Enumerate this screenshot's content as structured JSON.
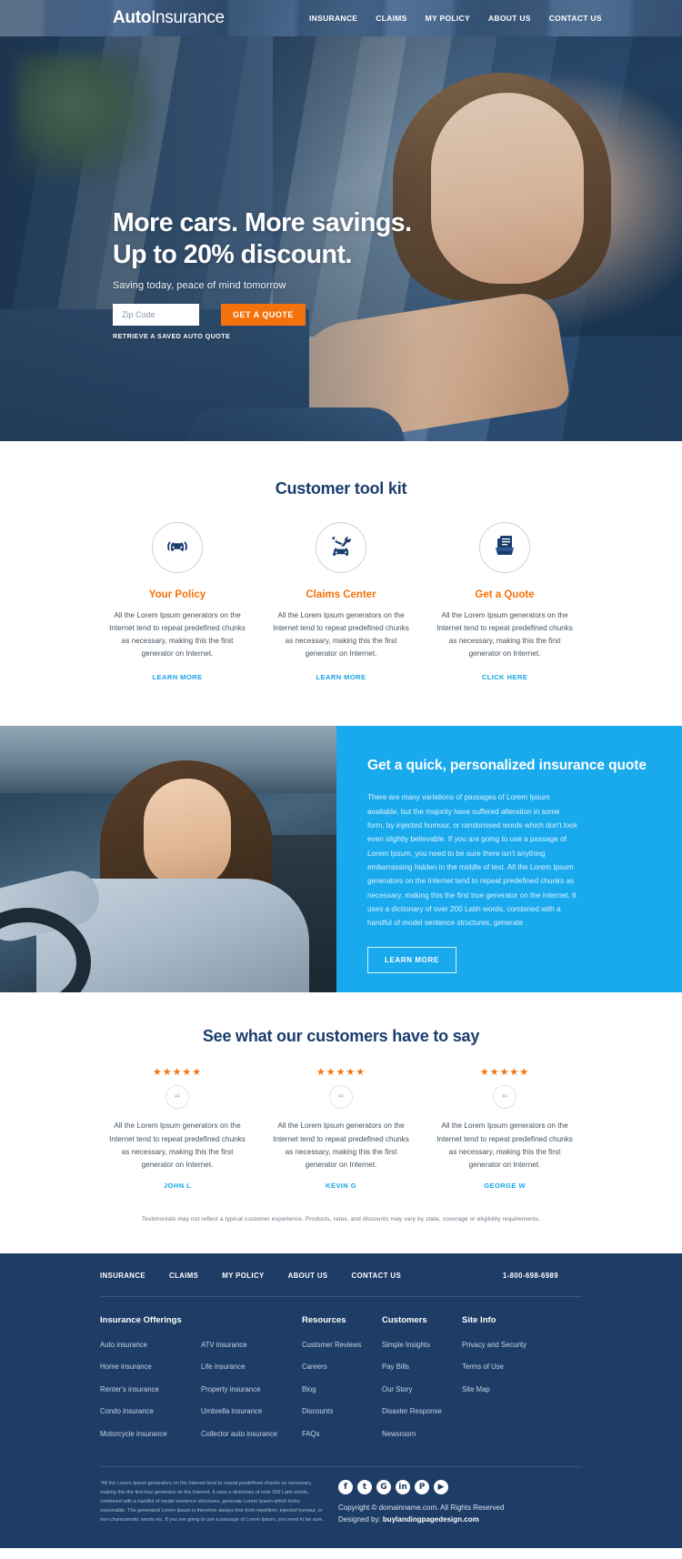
{
  "header": {
    "logo_bold": "Auto",
    "logo_light": "Insurance",
    "nav": [
      "INSURANCE",
      "CLAIMS",
      "MY POLICY",
      "ABOUT US",
      "CONTACT US"
    ]
  },
  "hero": {
    "title_line1": "More cars. More savings.",
    "title_line2": "Up to 20% discount.",
    "subtitle": "Saving today, peace of mind tomorrow",
    "zip_placeholder": "Zip Code",
    "zip_value": "",
    "cta_label": "GET A QUOTE",
    "retrieve_label": "RETRIEVE A SAVED AUTO QUOTE",
    "accent_color": "#f4720b"
  },
  "toolkit": {
    "title": "Customer tool kit",
    "cards": [
      {
        "icon": "car-in-hands-icon",
        "title": "Your Policy",
        "text": "All the Lorem Ipsum generators on the Internet tend to repeat predefined chunks as necessary, making this the first generator on Internet.",
        "link": "LEARN MORE"
      },
      {
        "icon": "car-wrench-icon",
        "title": "Claims Center",
        "text": "All the Lorem Ipsum generators on the Internet tend to repeat predefined chunks as necessary, making this the first generator on Internet.",
        "link": "LEARN MORE"
      },
      {
        "icon": "documents-folder-icon",
        "title": "Get a Quote",
        "text": "All the Lorem Ipsum generators on the Internet tend to repeat predefined chunks as necessary, making this the first generator on Internet.",
        "link": "CLICK HERE"
      }
    ]
  },
  "quote_section": {
    "heading": "Get a quick, personalized insurance quote",
    "body": "There are many variations of passages of Lorem Ipsum available, but the majority have suffered alteration in some form, by injected humour, or randomised words which don't look even slightly believable. If you are going to use a passage of Lorem Ipsum, you need to be sure there isn't anything embarrassing hidden in the middle of text. All the Lorem Ipsum generators on the Internet tend to repeat predefined chunks as necessary, making this the first true generator on the Internet. It uses a dictionary of over 200 Latin words, combined with a handful of model sentence structures, generate .",
    "button": "LEARN MORE",
    "background_color": "#19a9ed"
  },
  "testimonials": {
    "title": "See what our customers have to say",
    "items": [
      {
        "stars": "★★★★★",
        "quote_icon": "quote-mark-icon",
        "text": "All the Lorem Ipsum generators on the Internet tend to repeat predefined chunks as necessary, making this the first generator on Internet.",
        "author": "JOHN L"
      },
      {
        "stars": "★★★★★",
        "quote_icon": "quote-mark-icon",
        "text": "All the Lorem Ipsum generators on the Internet tend to repeat predefined chunks as necessary, making this the first generator on Internet.",
        "author": "KEVIN G"
      },
      {
        "stars": "★★★★★",
        "quote_icon": "quote-mark-icon",
        "text": "All the Lorem Ipsum generators on the Internet tend to repeat predefined chunks as necessary, making this the first generator on Internet.",
        "author": "GEORGE W"
      }
    ],
    "disclaimer": "Testimonials may not reflect a typical customer experience. Products, rates, and discounts may vary by state, coverage or eligibility requirements."
  },
  "footer": {
    "nav": [
      "INSURANCE",
      "CLAIMS",
      "MY POLICY",
      "ABOUT US",
      "CONTACT US"
    ],
    "phone": "1-800-698-6989",
    "phone_color": "#f4720b",
    "columns": {
      "offerings": {
        "heading": "Insurance Offerings",
        "col1": [
          "Auto insurance",
          "Home insurance",
          "Renter's insurance",
          "Condo insurance",
          "Motorcycle insurance"
        ],
        "col2": [
          "ATV insurance",
          "Life insurance",
          "Property insurance",
          "Umbrella insurance",
          "Collector auto insurance"
        ]
      },
      "resources": {
        "heading": "Resources",
        "links": [
          "Customer Reviews",
          "Careers",
          "Blog",
          "Discounts",
          "FAQs"
        ]
      },
      "customers": {
        "heading": "Customers",
        "links": [
          "Simple Insights",
          "Pay Bills",
          "Our Story",
          "Disaster Response",
          "Newsroom"
        ]
      },
      "siteinfo": {
        "heading": "Site Info",
        "links": [
          "Privacy and Security",
          "Terms of Use",
          "Site Map"
        ]
      }
    },
    "fine_print": "*All the Lorem Ipsum generators on the Internet tend to repeat predefined chunks as necessary, making this the first true generator on the Internet. It uses a dictionary of over 200 Latin words, combined with a handful of model sentence structures, generate Lorem Ipsum which looks reasonable. The generated Lorem Ipsum is therefore always free from repetition, injected humour, or non-characteristic words etc. If you are going to use a passage of Lorem Ipsum, you need to be sure.",
    "socials": [
      {
        "name": "facebook-icon",
        "glyph": "f"
      },
      {
        "name": "twitter-icon",
        "glyph": "t"
      },
      {
        "name": "google-plus-icon",
        "glyph": "G"
      },
      {
        "name": "linkedin-icon",
        "glyph": "in"
      },
      {
        "name": "pinterest-icon",
        "glyph": "P"
      },
      {
        "name": "youtube-icon",
        "glyph": "▶"
      }
    ],
    "copyright": "Copyright © domainname.com. All Rights Reserved",
    "designed_prefix": "Designed by: ",
    "designed_by": "buylandingpagedesign.com",
    "background_color": "#1d3c66"
  }
}
